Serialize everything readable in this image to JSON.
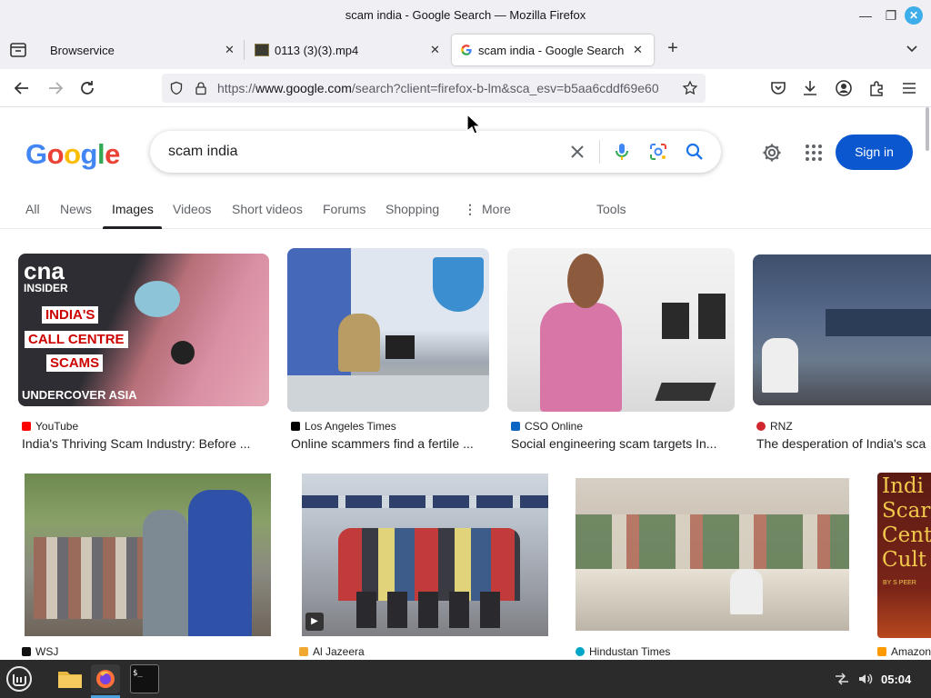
{
  "window": {
    "title": "scam india - Google Search — Mozilla Firefox"
  },
  "tabs": [
    {
      "label": "Browservice"
    },
    {
      "label": "0113 (3)(3).mp4"
    },
    {
      "label": "scam india - Google Search"
    }
  ],
  "nav": {
    "url_prefix": "https://",
    "url_host": "www.google.com",
    "url_path": "/search?client=firefox-b-lm&sca_esv=b5aa6cddf69e60"
  },
  "google": {
    "logo_letters": [
      "G",
      "o",
      "o",
      "g",
      "l",
      "e"
    ],
    "query": "scam india",
    "sign_in": "Sign in",
    "tabs": [
      "All",
      "News",
      "Images",
      "Videos",
      "Short videos",
      "Forums",
      "Shopping",
      "More",
      "Tools"
    ],
    "active_tab": "Images"
  },
  "images": [
    {
      "source": "YouTube",
      "title": "India's Thriving Scam Industry: Before ...",
      "overlay": [
        "cna",
        "INSIDER",
        "INDIA'S",
        "CALL CENTRE",
        "SCAMS",
        "UNDERCOVER ASIA"
      ]
    },
    {
      "source": "Los Angeles Times",
      "title": "Online scammers find a fertile ..."
    },
    {
      "source": "CSO Online",
      "title": "Social engineering scam targets In..."
    },
    {
      "source": "RNZ",
      "title": "The desperation of India's sca"
    },
    {
      "source": "WSJ",
      "title": ""
    },
    {
      "source": "Al Jazeera",
      "title": ""
    },
    {
      "source": "Hindustan Times",
      "title": ""
    },
    {
      "source": "Amazon",
      "title": "",
      "overlay": [
        "Indi",
        "Scar",
        "Cent",
        "Cult",
        "BY S PEER"
      ]
    }
  ],
  "colors": {
    "google_blue": "#4285f4",
    "google_red": "#ea4335",
    "google_yellow": "#fbbc05",
    "google_green": "#34a853",
    "sign_in_bg": "#0b57d0",
    "taskbar": "#2b2b2b"
  },
  "taskbar": {
    "clock": "05:04"
  }
}
